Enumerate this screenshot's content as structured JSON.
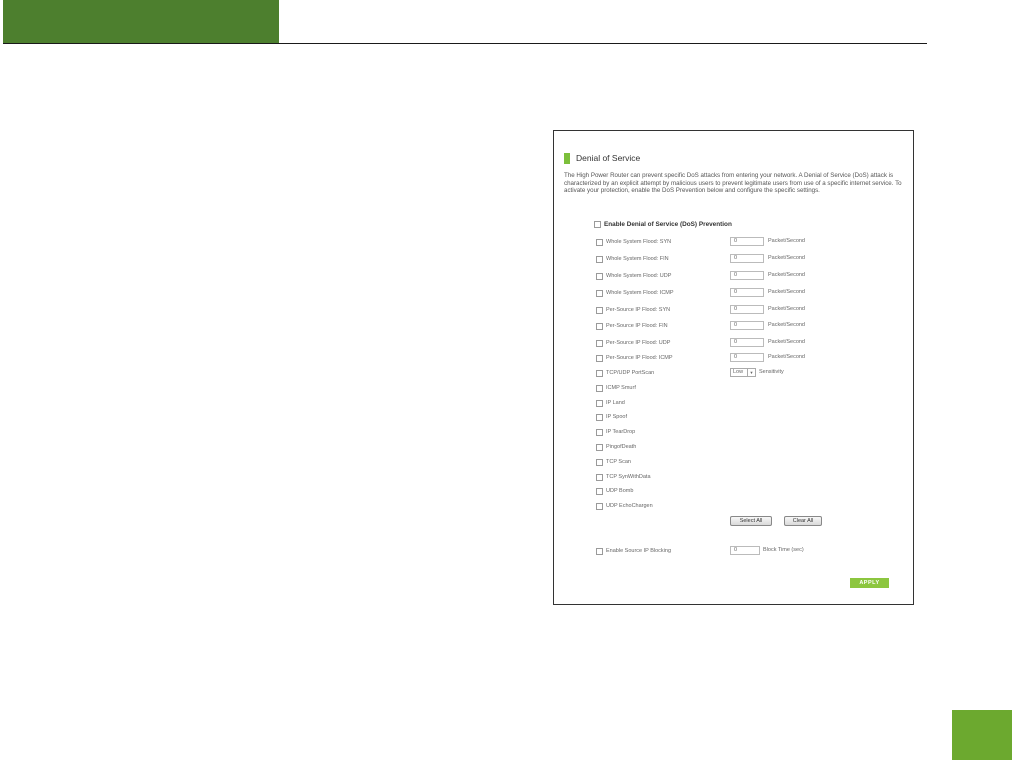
{
  "panel": {
    "title": "Denial of Service",
    "description": "The High Power Router can prevent specific DoS attacks from entering your network. A Denial of Service (DoS) attack is characterized by an explicit attempt by malicious users to prevent legitimate users from use of a specific internet service. To activate your protection, enable the DoS Prevention below and configure the specific settings.",
    "enable_label": "Enable Denial of Service (DoS) Prevention",
    "floods": [
      {
        "label": "Whole System Flood: SYN",
        "value": "0",
        "unit": "Packet/Second"
      },
      {
        "label": "Whole System Flood: FIN",
        "value": "0",
        "unit": "Packet/Second"
      },
      {
        "label": "Whole System Flood: UDP",
        "value": "0",
        "unit": "Packet/Second"
      },
      {
        "label": "Whole System Flood: ICMP",
        "value": "0",
        "unit": "Packet/Second"
      },
      {
        "label": "Per-Source IP Flood: SYN",
        "value": "0",
        "unit": "Packet/Second"
      },
      {
        "label": "Per-Source IP Flood: FIN",
        "value": "0",
        "unit": "Packet/Second"
      },
      {
        "label": "Per-Source IP Flood: UDP",
        "value": "0",
        "unit": "Packet/Second"
      },
      {
        "label": "Per-Source IP Flood: ICMP",
        "value": "0",
        "unit": "Packet/Second"
      }
    ],
    "portscan": {
      "label": "TCP/UDP PortScan",
      "selected": "Low",
      "suffix": "Sensitivity"
    },
    "options": [
      "ICMP Smurf",
      "IP Land",
      "IP Spoof",
      "IP TearDrop",
      "PingofDeath",
      "TCP Scan",
      "TCP SynWithData",
      "UDP Bomb",
      "UDP EchoChargen"
    ],
    "select_all": "Select All",
    "clear_all": "Clear All",
    "source_block": {
      "label": "Enable Source IP Blocking",
      "value": "0",
      "unit": "Block Time (sec)"
    },
    "apply": "APPLY"
  },
  "colors": {
    "header": "#4d7f2e",
    "corner": "#6ca92f",
    "accent": "#7cbf3b",
    "apply": "#8cc63f"
  }
}
